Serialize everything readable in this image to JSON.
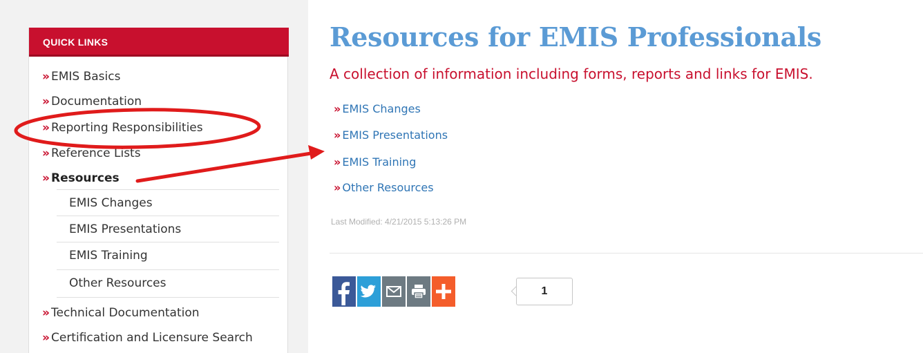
{
  "sidebar": {
    "header": "QUICK LINKS",
    "bullet": "»",
    "items": [
      {
        "label": "EMIS Basics"
      },
      {
        "label": "Documentation"
      },
      {
        "label": "Reporting Responsibilities"
      },
      {
        "label": "Reference Lists"
      },
      {
        "label": "Resources",
        "active": true
      }
    ],
    "sub_items": [
      {
        "label": "EMIS Changes"
      },
      {
        "label": "EMIS Presentations"
      },
      {
        "label": "EMIS Training"
      },
      {
        "label": "Other Resources"
      }
    ],
    "bottom_items": [
      {
        "label": "Technical Documentation"
      },
      {
        "label": "Certification and Licensure Search"
      }
    ]
  },
  "main": {
    "title": "Resources for EMIS Professionals",
    "subtitle": "A collection of information including forms, reports and links for EMIS.",
    "links": [
      {
        "label": "EMIS Changes"
      },
      {
        "label": "EMIS Presentations"
      },
      {
        "label": "EMIS Training"
      },
      {
        "label": "Other Resources"
      }
    ],
    "last_modified": "Last Modified: 4/21/2015 5:13:26 PM"
  },
  "share": {
    "buttons": [
      {
        "icon": "facebook-icon",
        "color": "#3b5998"
      },
      {
        "icon": "twitter-icon",
        "color": "#2d9fd8"
      },
      {
        "icon": "email-icon",
        "color": "#6d7a82"
      },
      {
        "icon": "print-icon",
        "color": "#6d7a82"
      },
      {
        "icon": "add-more-icon",
        "color": "#f45d2b"
      }
    ],
    "count": "1"
  },
  "colors": {
    "accent_red": "#c8102e",
    "link_blue": "#2f75b5",
    "title_blue": "#5b9bd5",
    "annotation_red": "#e01b1b"
  }
}
